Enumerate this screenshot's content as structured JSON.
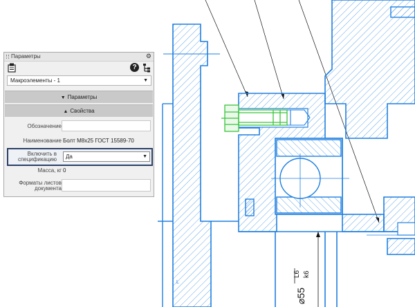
{
  "panel": {
    "title": "Параметры",
    "macro_select": "Макроэлементы - 1",
    "section_params": "Параметры",
    "section_props": "Свойства",
    "fields": {
      "designation_label": "Обозначение",
      "designation_value": "",
      "name_label": "Наименование",
      "name_value": "Болт M8x25 ГОСТ 15589-70",
      "include_label_1": "Включить в",
      "include_label_2": "спецификацию",
      "include_value": "Да",
      "mass_label": "Масса, кг",
      "mass_value": "0",
      "formats_label_1": "Форматы листов",
      "formats_label_2": "документа",
      "formats_value": ""
    }
  },
  "drawing": {
    "dim_text": "⌀55",
    "fit_text_top": "L6",
    "fit_text_bottom": "k6"
  },
  "colors": {
    "line": "#1e7fe0",
    "bolt": "#39c43a",
    "panel_highlight": "#2a3f66"
  }
}
